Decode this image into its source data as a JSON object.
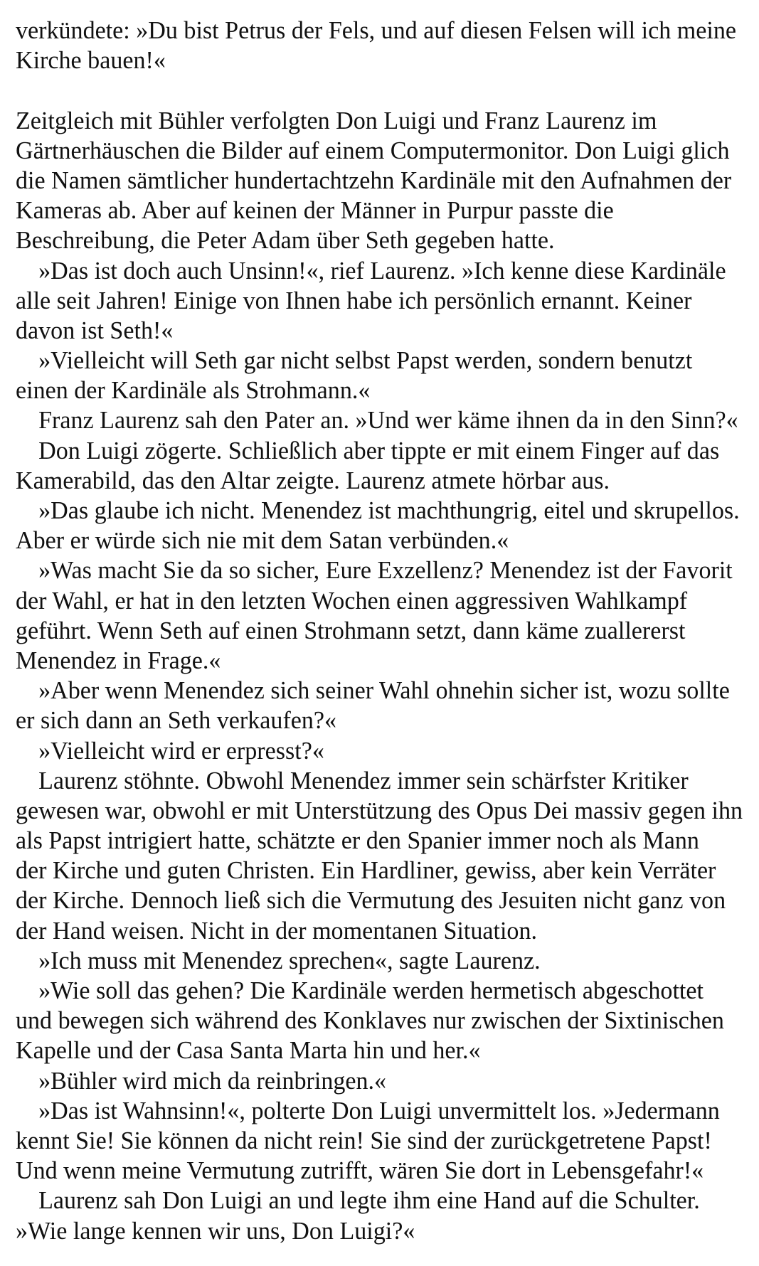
{
  "lines": [
    {
      "t": "verkündete: »Du bist Petrus der Fels, und auf diesen Felsen will ich meine",
      "i": false
    },
    {
      "t": "Kirche bauen!«",
      "i": false
    },
    {
      "t": "",
      "i": false
    },
    {
      "t": "Zeitgleich mit Bühler verfolgten Don Luigi und Franz Laurenz im",
      "i": false
    },
    {
      "t": "Gärtnerhäuschen die Bilder auf einem Computermonitor. Don Luigi glich",
      "i": false
    },
    {
      "t": "die Namen sämtlicher hundertachtzehn Kardinäle mit den Aufnahmen der",
      "i": false
    },
    {
      "t": "Kameras ab. Aber auf keinen der Männer in Purpur passte die",
      "i": false
    },
    {
      "t": "Beschreibung, die Peter Adam über Seth gegeben hatte.",
      "i": false
    },
    {
      "t": "»Das ist doch auch Unsinn!«, rief Laurenz. »Ich kenne diese Kardinäle",
      "i": true
    },
    {
      "t": "alle seit Jahren! Einige von Ihnen habe ich persönlich ernannt. Keiner",
      "i": false
    },
    {
      "t": "davon ist Seth!«",
      "i": false
    },
    {
      "t": "»Vielleicht will Seth gar nicht selbst Papst werden, sondern benutzt",
      "i": true
    },
    {
      "t": "einen der Kardinäle als Strohmann.«",
      "i": false
    },
    {
      "t": "Franz Laurenz sah den Pater an. »Und wer käme ihnen da in den Sinn?«",
      "i": true
    },
    {
      "t": "Don Luigi zögerte. Schließlich aber tippte er mit einem Finger auf das",
      "i": true
    },
    {
      "t": "Kamerabild, das den Altar zeigte. Laurenz atmete hörbar aus.",
      "i": false
    },
    {
      "t": "»Das glaube ich nicht. Menendez ist machthungrig, eitel und skrupellos.",
      "i": true
    },
    {
      "t": "Aber er würde sich nie mit dem Satan verbünden.«",
      "i": false
    },
    {
      "t": "»Was macht Sie da so sicher, Eure Exzellenz? Menendez ist der Favorit",
      "i": true
    },
    {
      "t": "der Wahl, er hat in den letzten Wochen einen aggressiven Wahlkampf",
      "i": false
    },
    {
      "t": "geführt. Wenn Seth auf einen Strohmann setzt, dann käme zuallererst",
      "i": false
    },
    {
      "t": "Menendez in Frage.«",
      "i": false
    },
    {
      "t": "»Aber wenn Menendez sich seiner Wahl ohnehin sicher ist, wozu sollte",
      "i": true
    },
    {
      "t": "er sich dann an Seth verkaufen?«",
      "i": false
    },
    {
      "t": "»Vielleicht wird er erpresst?«",
      "i": true
    },
    {
      "t": "Laurenz stöhnte. Obwohl Menendez immer sein schärfster Kritiker",
      "i": true
    },
    {
      "t": "gewesen war, obwohl er mit Unterstützung des Opus Dei massiv gegen ihn",
      "i": false
    },
    {
      "t": "als Papst intrigiert hatte, schätzte er den Spanier immer noch als Mann",
      "i": false
    },
    {
      "t": "der Kirche und guten Christen. Ein Hardliner, gewiss, aber kein Verräter",
      "i": false
    },
    {
      "t": "der Kirche. Dennoch ließ sich die Vermutung des Jesuiten nicht ganz von",
      "i": false
    },
    {
      "t": "der Hand weisen. Nicht in der momentanen Situation.",
      "i": false
    },
    {
      "t": "»Ich muss mit Menendez sprechen«, sagte Laurenz.",
      "i": true
    },
    {
      "t": "»Wie soll das gehen? Die Kardinäle werden hermetisch abgeschottet",
      "i": true
    },
    {
      "t": "und bewegen sich während des Konklaves nur zwischen der Sixtinischen",
      "i": false
    },
    {
      "t": "Kapelle und der Casa Santa Marta hin und her.«",
      "i": false
    },
    {
      "t": "»Bühler wird mich da reinbringen.«",
      "i": true
    },
    {
      "t": "»Das ist Wahnsinn!«, polterte Don Luigi unvermittelt los. »Jedermann",
      "i": true
    },
    {
      "t": "kennt Sie! Sie können da nicht rein! Sie sind der zurückgetretene Papst!",
      "i": false
    },
    {
      "t": "Und wenn meine Vermutung zutrifft, wären Sie dort in Lebensgefahr!«",
      "i": false
    },
    {
      "t": "Laurenz sah Don Luigi an und legte ihm eine Hand auf die Schulter.",
      "i": true
    },
    {
      "t": "»Wie lange kennen wir uns, Don Luigi?«",
      "i": false
    }
  ]
}
